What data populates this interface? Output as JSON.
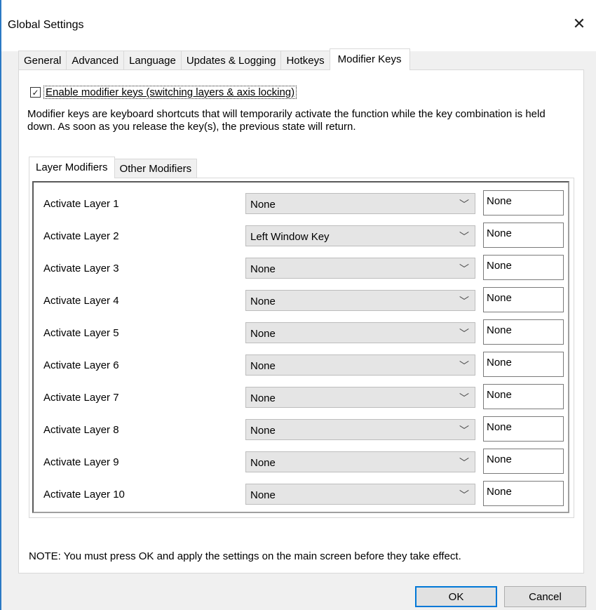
{
  "window": {
    "title": "Global Settings"
  },
  "tabs": [
    {
      "label": "General"
    },
    {
      "label": "Advanced"
    },
    {
      "label": "Language"
    },
    {
      "label": "Updates & Logging"
    },
    {
      "label": "Hotkeys"
    },
    {
      "label": "Modifier Keys",
      "active": true
    }
  ],
  "modifier_keys": {
    "enable_label": "Enable modifier keys (switching layers & axis locking)",
    "enabled": true,
    "description": "Modifier keys are keyboard shortcuts that will temporarily activate the function while the key combination is held down. As soon as you release the key(s), the previous state will return.",
    "inner_tabs": [
      {
        "label": "Layer Modifiers",
        "active": true
      },
      {
        "label": "Other Modifiers"
      }
    ],
    "rows": [
      {
        "label": "Activate Layer 1",
        "combo": "None",
        "key": "None"
      },
      {
        "label": "Activate Layer 2",
        "combo": "Left Window Key",
        "key": "None"
      },
      {
        "label": "Activate Layer 3",
        "combo": "None",
        "key": "None"
      },
      {
        "label": "Activate Layer 4",
        "combo": "None",
        "key": "None"
      },
      {
        "label": "Activate Layer 5",
        "combo": "None",
        "key": "None"
      },
      {
        "label": "Activate Layer 6",
        "combo": "None",
        "key": "None"
      },
      {
        "label": "Activate Layer 7",
        "combo": "None",
        "key": "None"
      },
      {
        "label": "Activate Layer 8",
        "combo": "None",
        "key": "None"
      },
      {
        "label": "Activate Layer 9",
        "combo": "None",
        "key": "None"
      },
      {
        "label": "Activate Layer 10",
        "combo": "None",
        "key": "None"
      }
    ],
    "note": "NOTE: You must press OK and apply the settings on the main screen before they take effect."
  },
  "buttons": {
    "ok": "OK",
    "cancel": "Cancel"
  },
  "icons": {
    "close": "close-icon",
    "checkbox": "check-icon",
    "dropdown": "chevron-down-icon"
  },
  "colors": {
    "accent": "#0078d7",
    "window_border": "#2b79c4"
  }
}
